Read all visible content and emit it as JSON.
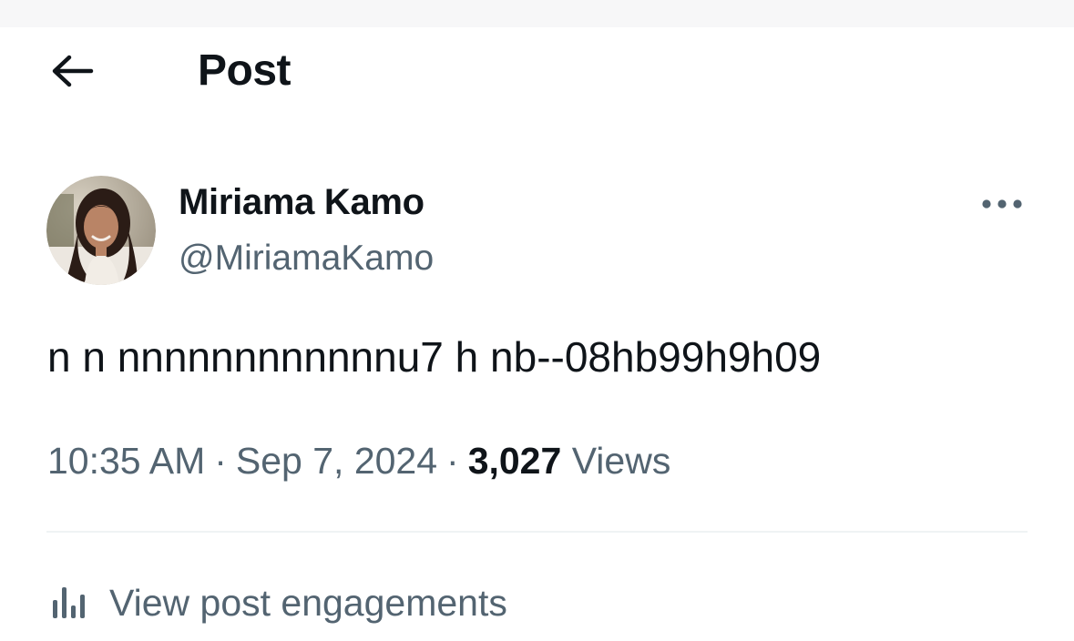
{
  "header": {
    "back_icon": "arrow-left-icon",
    "title": "Post"
  },
  "author": {
    "name": "Miriama Kamo",
    "handle": "@MiriamaKamo",
    "more_icon": "more-horizontal-icon"
  },
  "post": {
    "text": "n n nnnnnnnnnnnnu7 h nb--08hb99h9h09"
  },
  "meta": {
    "time": "10:35 AM",
    "separator": "·",
    "date": "Sep 7, 2024",
    "views_count": "3,027",
    "views_label": "Views"
  },
  "engagements": {
    "icon": "bar-chart-icon",
    "label": "View post engagements"
  },
  "colors": {
    "text_primary": "#0f1419",
    "text_secondary": "#536471",
    "divider": "#eff3f4",
    "background": "#ffffff"
  }
}
